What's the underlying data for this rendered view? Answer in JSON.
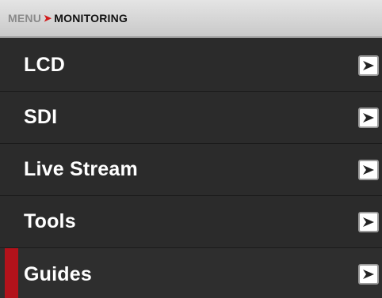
{
  "breadcrumb": {
    "root": "MENU",
    "separator": "➤",
    "current": "MONITORING"
  },
  "menu": {
    "items": [
      {
        "label": "LCD",
        "icon": "chevron-right-icon"
      },
      {
        "label": "SDI",
        "icon": "chevron-right-icon"
      },
      {
        "label": "Live Stream",
        "icon": "chevron-right-icon"
      },
      {
        "label": "Tools",
        "icon": "chevron-right-icon"
      },
      {
        "label": "Guides",
        "icon": "chevron-right-icon",
        "selected": true
      }
    ]
  },
  "colors": {
    "background": "#2b2b2b",
    "header": "#d6d6d6",
    "accent": "#b3121b",
    "separator_arrow": "#d11a1a",
    "text": "#ffffff"
  }
}
